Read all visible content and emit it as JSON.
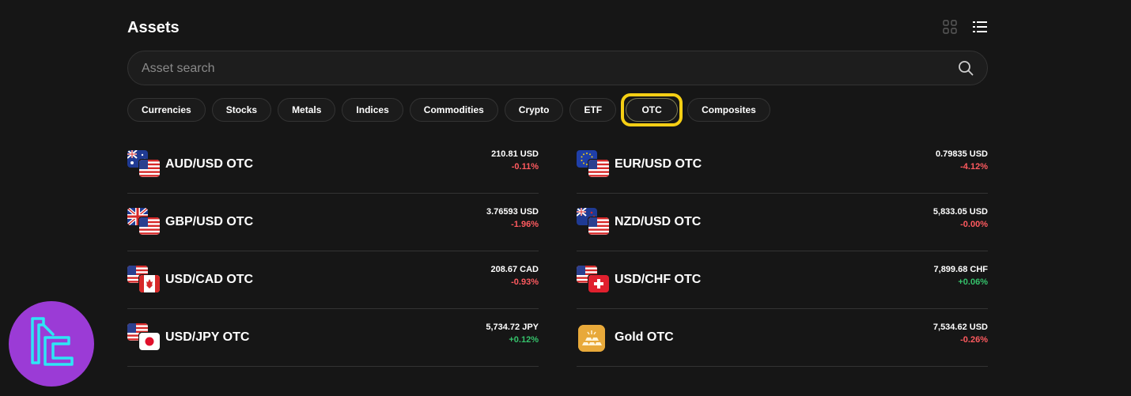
{
  "header": {
    "title": "Assets"
  },
  "search": {
    "placeholder": "Asset search"
  },
  "tabs": [
    {
      "label": "Currencies"
    },
    {
      "label": "Stocks"
    },
    {
      "label": "Metals"
    },
    {
      "label": "Indices"
    },
    {
      "label": "Commodities"
    },
    {
      "label": "Crypto"
    },
    {
      "label": "ETF"
    },
    {
      "label": "OTC",
      "active": true
    },
    {
      "label": "Composites"
    }
  ],
  "assets_left": [
    {
      "name": "AUD/USD OTC",
      "price": "210.81 USD",
      "change": "-0.11%"
    },
    {
      "name": "GBP/USD OTC",
      "price": "3.76593 USD",
      "change": "-1.96%"
    },
    {
      "name": "USD/CAD OTC",
      "price": "208.67 CAD",
      "change": "-0.93%"
    },
    {
      "name": "USD/JPY OTC",
      "price": "5,734.72 JPY",
      "change": "+0.12%"
    }
  ],
  "assets_right": [
    {
      "name": "EUR/USD OTC",
      "price": "0.79835 USD",
      "change": "-4.12%"
    },
    {
      "name": "NZD/USD OTC",
      "price": "5,833.05 USD",
      "change": "-0.00%"
    },
    {
      "name": "USD/CHF OTC",
      "price": "7,899.68 CHF",
      "change": "+0.06%"
    },
    {
      "name": "Gold OTC",
      "price": "7,534.62 USD",
      "change": "-0.26%"
    }
  ],
  "colors": {
    "background": "#161616",
    "negative": "#ff5a5f",
    "positive": "#35c26b",
    "highlight": "#f5cf14",
    "logo": "#9b3bd6"
  }
}
